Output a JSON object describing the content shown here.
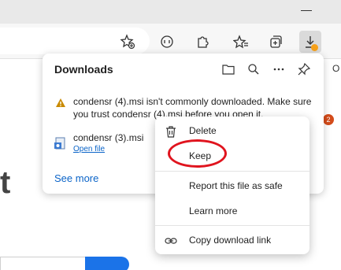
{
  "panel": {
    "title": "Downloads",
    "items": [
      {
        "line1": "condensr (4).msi isn't commonly downloaded. Make sure",
        "line2": "you trust condensr (4).msi before you open it."
      },
      {
        "filename": "condensr (3).msi",
        "action": "Open file"
      }
    ],
    "see_more": "See more"
  },
  "context_menu": {
    "items": [
      "Delete",
      "Keep",
      "Report this file as safe",
      "Learn more",
      "Copy download link"
    ]
  },
  "page": {
    "badge": "2",
    "big_letter": "t",
    "partial_letter": "O"
  },
  "colors": {
    "accent": "#0b64c8",
    "warning": "#f7a11a",
    "annotation": "#e0141e"
  }
}
